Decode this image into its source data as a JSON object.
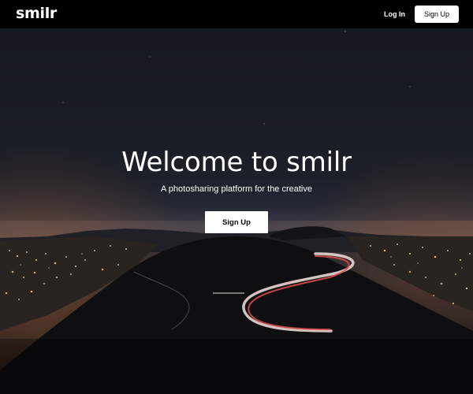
{
  "brand": {
    "logo_text": "smilr"
  },
  "navbar": {
    "login_label": "Log In",
    "signup_label": "Sign Up"
  },
  "hero": {
    "title": "Welcome to smilr",
    "subtitle": "A photosharing platform for the creative",
    "cta_label": "Sign Up",
    "background_image": "night-city-hills-light-trails-photo"
  },
  "colors": {
    "navbar_bg": "#000000",
    "button_bg": "#ffffff",
    "button_text": "#000000",
    "hero_text": "#ffffff",
    "sky": "#1b1e26"
  }
}
